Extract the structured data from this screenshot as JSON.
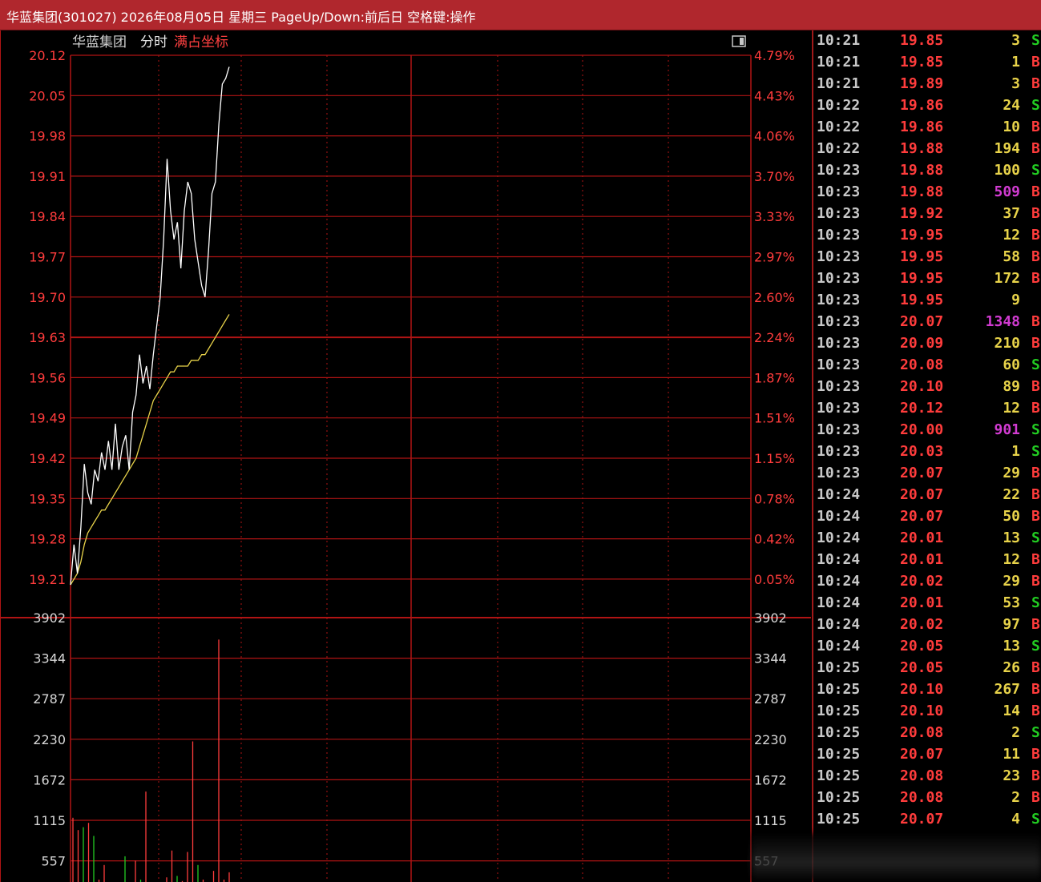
{
  "window": {
    "title": "华蓝集团(301027) 2026年08月05日 星期三 PageUp/Down:前后日 空格键:操作"
  },
  "chart_header": {
    "name": "华蓝集团",
    "mode": "分时",
    "scale_mode": "满占坐标"
  },
  "colors": {
    "grid": "#b01414",
    "price_line": "#ffffff",
    "avg_line": "#e8d34a",
    "up": "#ff3c3c",
    "down": "#22cc22",
    "vol_text": "#e8d34a",
    "big_vol": "#d13bd1",
    "title_bg": "#b0272d"
  },
  "chart_data": {
    "type": "line",
    "price_axis_left": [
      "20.12",
      "20.05",
      "19.98",
      "19.91",
      "19.84",
      "19.77",
      "19.70",
      "19.63",
      "19.56",
      "19.49",
      "19.42",
      "19.35",
      "19.28",
      "19.21"
    ],
    "price_axis_right": [
      "4.79%",
      "4.43%",
      "4.06%",
      "3.70%",
      "3.33%",
      "2.97%",
      "2.60%",
      "2.24%",
      "1.87%",
      "1.51%",
      "1.15%",
      "0.78%",
      "0.42%",
      "0.05%"
    ],
    "volume_axis": [
      "3902",
      "3344",
      "2787",
      "2230",
      "1672",
      "1115",
      "557"
    ],
    "ylim": [
      19.18,
      20.12
    ],
    "series": [
      {
        "values": [
          19.2,
          19.27,
          19.22,
          19.3,
          19.41,
          19.36,
          19.34,
          19.4,
          19.38,
          19.43,
          19.4,
          19.45,
          19.4,
          19.48,
          19.4,
          19.44,
          19.46,
          19.4,
          19.5,
          19.53,
          19.6,
          19.55,
          19.58,
          19.54,
          19.6,
          19.65,
          19.7,
          19.8,
          19.94,
          19.85,
          19.8,
          19.83,
          19.75,
          19.85,
          19.9,
          19.88,
          19.8,
          19.76,
          19.72,
          19.7,
          19.78,
          19.88,
          19.9,
          20.0,
          20.07,
          20.08,
          20.1
        ]
      },
      {
        "values": [
          19.2,
          19.21,
          19.22,
          19.24,
          19.27,
          19.29,
          19.3,
          19.31,
          19.32,
          19.33,
          19.33,
          19.34,
          19.35,
          19.36,
          19.37,
          19.38,
          19.39,
          19.4,
          19.41,
          19.42,
          19.44,
          19.46,
          19.48,
          19.5,
          19.52,
          19.53,
          19.54,
          19.55,
          19.56,
          19.57,
          19.57,
          19.58,
          19.58,
          19.58,
          19.58,
          19.59,
          19.59,
          19.59,
          19.6,
          19.6,
          19.61,
          19.62,
          19.63,
          19.64,
          19.65,
          19.66,
          19.67
        ]
      }
    ],
    "volume": [
      {
        "v": 1150,
        "c": "up"
      },
      {
        "v": 980,
        "c": "up"
      },
      {
        "v": 1020,
        "c": "down"
      },
      {
        "v": 1080,
        "c": "up"
      },
      {
        "v": 900,
        "c": "down"
      },
      {
        "v": 300,
        "c": "up"
      },
      {
        "v": 500,
        "c": "up"
      },
      {
        "v": 200,
        "c": "down"
      },
      {
        "v": 150,
        "c": "up"
      },
      {
        "v": 260,
        "c": "down"
      },
      {
        "v": 620,
        "c": "down"
      },
      {
        "v": 120,
        "c": "up"
      },
      {
        "v": 560,
        "c": "up"
      },
      {
        "v": 300,
        "c": "down"
      },
      {
        "v": 1510,
        "c": "up"
      },
      {
        "v": 180,
        "c": "down"
      },
      {
        "v": 100,
        "c": "up"
      },
      {
        "v": 240,
        "c": "up"
      },
      {
        "v": 330,
        "c": "up"
      },
      {
        "v": 700,
        "c": "up"
      },
      {
        "v": 350,
        "c": "down"
      },
      {
        "v": 280,
        "c": "up"
      },
      {
        "v": 680,
        "c": "up"
      },
      {
        "v": 2200,
        "c": "up"
      },
      {
        "v": 500,
        "c": "down"
      },
      {
        "v": 300,
        "c": "up"
      },
      {
        "v": 250,
        "c": "up"
      },
      {
        "v": 420,
        "c": "up"
      },
      {
        "v": 3600,
        "c": "up"
      },
      {
        "v": 300,
        "c": "up"
      },
      {
        "v": 400,
        "c": "up"
      }
    ]
  },
  "ticks": [
    {
      "time": "10:21",
      "price": "19.85",
      "vol": "3",
      "side": "S"
    },
    {
      "time": "10:21",
      "price": "19.85",
      "vol": "1",
      "side": "B"
    },
    {
      "time": "10:21",
      "price": "19.89",
      "vol": "3",
      "side": "B"
    },
    {
      "time": "10:22",
      "price": "19.86",
      "vol": "24",
      "side": "S"
    },
    {
      "time": "10:22",
      "price": "19.86",
      "vol": "10",
      "side": "B"
    },
    {
      "time": "10:22",
      "price": "19.88",
      "vol": "194",
      "side": "B"
    },
    {
      "time": "10:23",
      "price": "19.88",
      "vol": "100",
      "side": "S"
    },
    {
      "time": "10:23",
      "price": "19.88",
      "vol": "509",
      "side": "B",
      "big": true
    },
    {
      "time": "10:23",
      "price": "19.92",
      "vol": "37",
      "side": "B"
    },
    {
      "time": "10:23",
      "price": "19.95",
      "vol": "12",
      "side": "B"
    },
    {
      "time": "10:23",
      "price": "19.95",
      "vol": "58",
      "side": "B"
    },
    {
      "time": "10:23",
      "price": "19.95",
      "vol": "172",
      "side": "B"
    },
    {
      "time": "10:23",
      "price": "19.95",
      "vol": "9",
      "side": ""
    },
    {
      "time": "10:23",
      "price": "20.07",
      "vol": "1348",
      "side": "B",
      "big": true
    },
    {
      "time": "10:23",
      "price": "20.09",
      "vol": "210",
      "side": "B"
    },
    {
      "time": "10:23",
      "price": "20.08",
      "vol": "60",
      "side": "S"
    },
    {
      "time": "10:23",
      "price": "20.10",
      "vol": "89",
      "side": "B"
    },
    {
      "time": "10:23",
      "price": "20.12",
      "vol": "12",
      "side": "B"
    },
    {
      "time": "10:23",
      "price": "20.00",
      "vol": "901",
      "side": "S",
      "big": true
    },
    {
      "time": "10:23",
      "price": "20.03",
      "vol": "1",
      "side": "S"
    },
    {
      "time": "10:23",
      "price": "20.07",
      "vol": "29",
      "side": "B"
    },
    {
      "time": "10:24",
      "price": "20.07",
      "vol": "22",
      "side": "B"
    },
    {
      "time": "10:24",
      "price": "20.07",
      "vol": "50",
      "side": "B"
    },
    {
      "time": "10:24",
      "price": "20.01",
      "vol": "13",
      "side": "S"
    },
    {
      "time": "10:24",
      "price": "20.01",
      "vol": "12",
      "side": "B"
    },
    {
      "time": "10:24",
      "price": "20.02",
      "vol": "29",
      "side": "B"
    },
    {
      "time": "10:24",
      "price": "20.01",
      "vol": "53",
      "side": "S"
    },
    {
      "time": "10:24",
      "price": "20.02",
      "vol": "97",
      "side": "B"
    },
    {
      "time": "10:24",
      "price": "20.05",
      "vol": "13",
      "side": "S"
    },
    {
      "time": "10:25",
      "price": "20.05",
      "vol": "26",
      "side": "B"
    },
    {
      "time": "10:25",
      "price": "20.10",
      "vol": "267",
      "side": "B"
    },
    {
      "time": "10:25",
      "price": "20.10",
      "vol": "14",
      "side": "B"
    },
    {
      "time": "10:25",
      "price": "20.08",
      "vol": "2",
      "side": "S"
    },
    {
      "time": "10:25",
      "price": "20.07",
      "vol": "11",
      "side": "B"
    },
    {
      "time": "10:25",
      "price": "20.08",
      "vol": "23",
      "side": "B"
    },
    {
      "time": "10:25",
      "price": "20.08",
      "vol": "2",
      "side": "B"
    },
    {
      "time": "10:25",
      "price": "20.07",
      "vol": "4",
      "side": "S"
    }
  ]
}
